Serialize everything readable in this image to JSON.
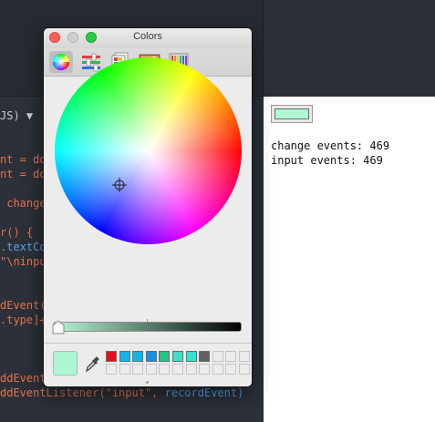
{
  "window": {
    "title": "Colors"
  },
  "toolbar": {
    "tools": [
      {
        "name": "Color Wheel",
        "active": true
      },
      {
        "name": "Color Sliders",
        "active": false
      },
      {
        "name": "Color Palettes",
        "active": false
      },
      {
        "name": "Image Palettes",
        "active": false
      },
      {
        "name": "Pencils",
        "active": false
      }
    ]
  },
  "picker": {
    "current_color": "#aef7d2",
    "brightness_gradient": [
      "#b7f9d8",
      "#000000"
    ]
  },
  "swatches": {
    "row1": [
      "#e0101c",
      "#12b6e6",
      "#12b6e6",
      "#1a8fe0",
      "#23c383",
      "#43dcc9",
      "#34e1cf",
      "#606060",
      "",
      "",
      ""
    ],
    "row2": [
      "",
      "",
      "",
      "",
      "",
      "",
      "",
      "",
      "",
      "",
      ""
    ]
  },
  "editor": {
    "language_label": "JS) ▼",
    "lines": [
      {
        "a": "nt = do",
        "b": ""
      },
      {
        "a": "nt = do",
        "b": ""
      },
      {
        "a": " change",
        "b": ""
      },
      {
        "a": "r() {",
        "b": ""
      },
      {
        "a": ".textCo",
        "b": ""
      },
      {
        "a": "\"\\ninpu",
        "b": ""
      },
      {
        "a": "dEvent(",
        "b": ""
      },
      {
        "a": ".type]+",
        "b": ""
      },
      {
        "a": "ddEvent",
        "b": ""
      },
      {
        "a": "ddEventListener(\"input\", ",
        "b": "recordEvent)"
      }
    ]
  },
  "preview": {
    "color_value": "#aef7d2",
    "change_events": "change events: 469",
    "input_events": "input events: 469"
  }
}
